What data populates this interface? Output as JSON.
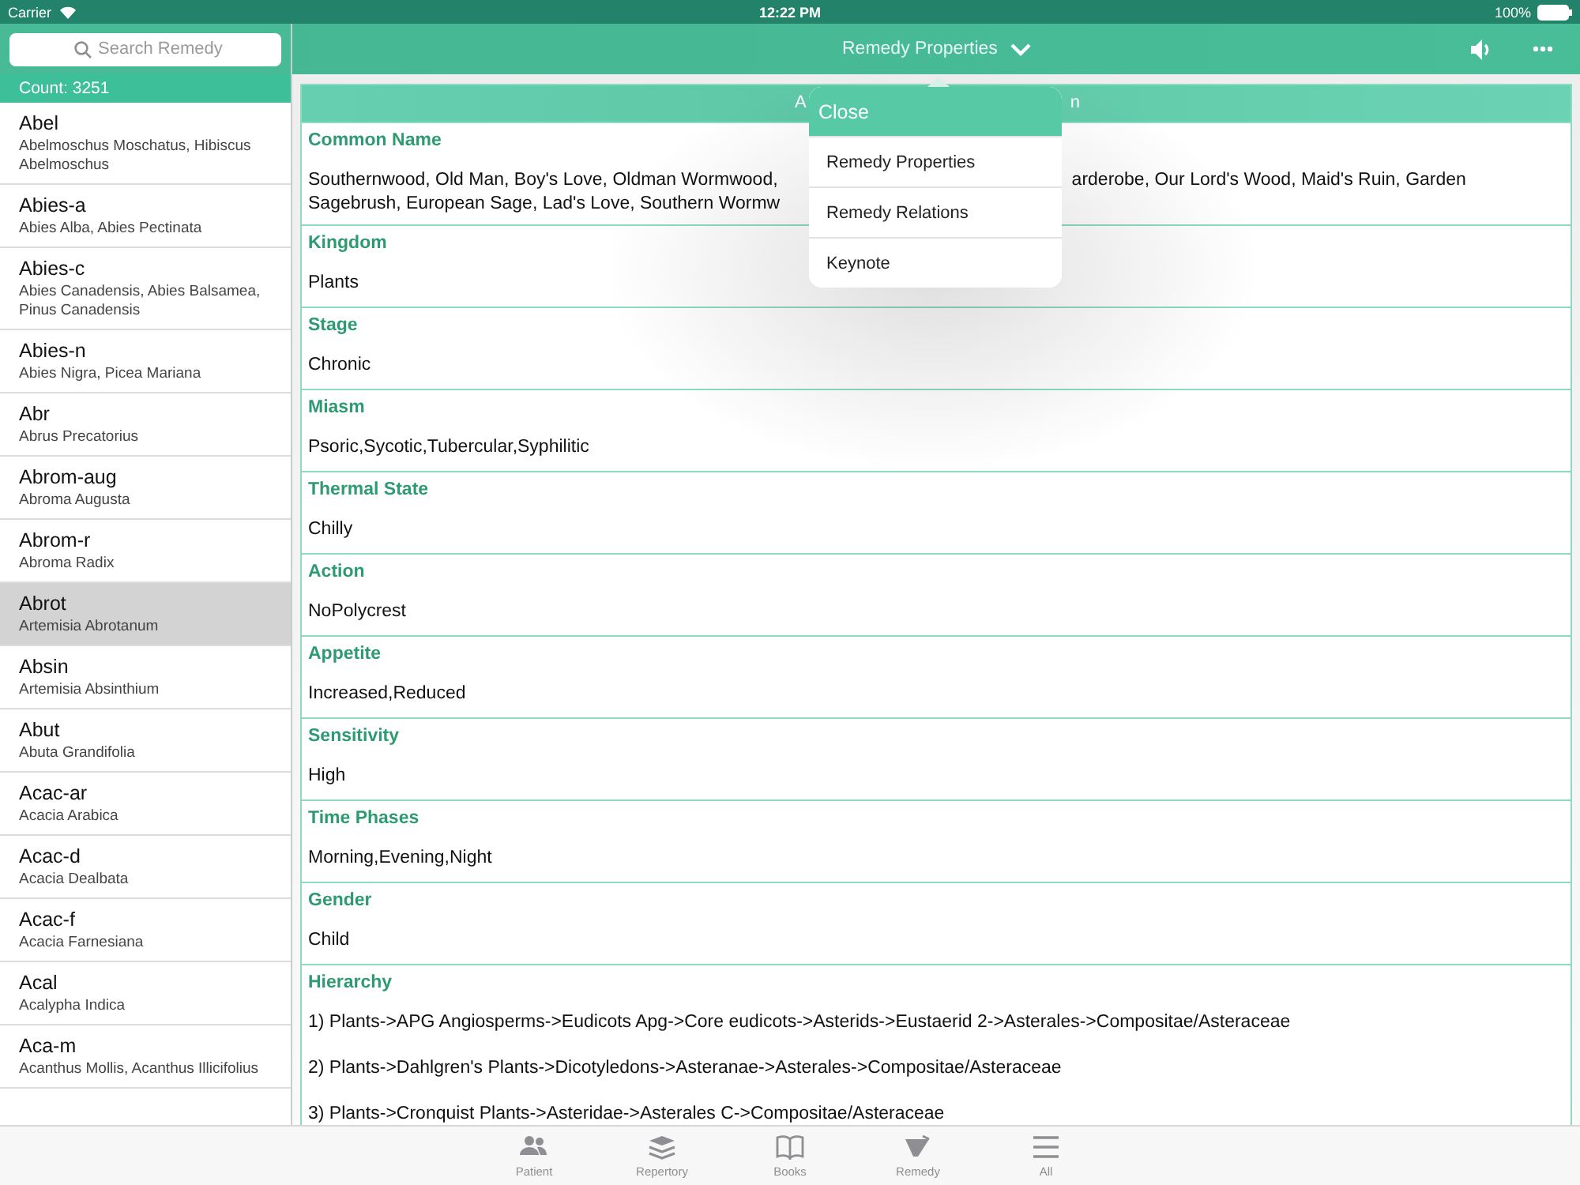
{
  "status_bar": {
    "carrier": "Carrier",
    "time": "12:22 PM",
    "battery": "100%"
  },
  "search": {
    "placeholder": "Search Remedy"
  },
  "nav": {
    "title": "Remedy Properties"
  },
  "count": "Count: 3251",
  "remedies": [
    {
      "abbr": "Abel",
      "name": "Abelmoschus Moschatus, Hibiscus Abelmoschus",
      "selected": false
    },
    {
      "abbr": "Abies-a",
      "name": "Abies Alba, Abies Pectinata",
      "selected": false
    },
    {
      "abbr": "Abies-c",
      "name": "Abies Canadensis, Abies Balsamea, Pinus Canadensis",
      "selected": false
    },
    {
      "abbr": "Abies-n",
      "name": "Abies Nigra, Picea Mariana",
      "selected": false
    },
    {
      "abbr": "Abr",
      "name": "Abrus Precatorius",
      "selected": false
    },
    {
      "abbr": "Abrom-aug",
      "name": "Abroma Augusta",
      "selected": false
    },
    {
      "abbr": "Abrom-r",
      "name": "Abroma Radix",
      "selected": false
    },
    {
      "abbr": "Abrot",
      "name": "Artemisia Abrotanum",
      "selected": true
    },
    {
      "abbr": "Absin",
      "name": "Artemisia Absinthium",
      "selected": false
    },
    {
      "abbr": "Abut",
      "name": "Abuta Grandifolia",
      "selected": false
    },
    {
      "abbr": "Acac-ar",
      "name": "Acacia Arabica",
      "selected": false
    },
    {
      "abbr": "Acac-d",
      "name": "Acacia Dealbata",
      "selected": false
    },
    {
      "abbr": "Acac-f",
      "name": "Acacia Farnesiana",
      "selected": false
    },
    {
      "abbr": "Acal",
      "name": "Acalypha Indica",
      "selected": false
    },
    {
      "abbr": "Aca-m",
      "name": "Acanthus Mollis, Acanthus Illicifolius",
      "selected": false
    }
  ],
  "header_fragments": [
    "A",
    "n"
  ],
  "properties": [
    {
      "label": "Common Name",
      "lines": [
        [
          "Southernwood, Old Man, Boy's Love, Oldman Wormwood,",
          "arderobe, Our Lord's Wood, Maid's Ruin, Garden"
        ],
        [
          "Sagebrush, European Sage, Lad's Love, Southern Wormw"
        ]
      ]
    },
    {
      "label": "Kingdom",
      "lines": [
        [
          "Plants"
        ]
      ]
    },
    {
      "label": "Stage",
      "lines": [
        [
          "Chronic"
        ]
      ]
    },
    {
      "label": "Miasm",
      "lines": [
        [
          "Psoric,Sycotic,Tubercular,Syphilitic"
        ]
      ]
    },
    {
      "label": "Thermal State",
      "lines": [
        [
          "Chilly"
        ]
      ]
    },
    {
      "label": "Action",
      "lines": [
        [
          "NoPolycrest"
        ]
      ]
    },
    {
      "label": "Appetite",
      "lines": [
        [
          "Increased,Reduced"
        ]
      ]
    },
    {
      "label": "Sensitivity",
      "lines": [
        [
          "High"
        ]
      ]
    },
    {
      "label": "Time Phases",
      "lines": [
        [
          "Morning,Evening,Night"
        ]
      ]
    },
    {
      "label": "Gender",
      "lines": [
        [
          "Child"
        ]
      ]
    },
    {
      "label": "Hierarchy",
      "paragraphs": [
        "1) Plants->APG Angiosperms->Eudicots Apg->Core eudicots->Asterids->Eustaerid 2->Asterales->Compositae/Asteraceae",
        "2) Plants->Dahlgren's Plants->Dicotyledons->Asteranae->Asterales->Compositae/Asteraceae",
        "3) Plants->Cronquist Plants->Asteridae->Asterales C->Compositae/Asteraceae"
      ]
    }
  ],
  "popover": {
    "close": "Close",
    "items": [
      "Remedy Properties",
      "Remedy Relations",
      "Keynote"
    ]
  },
  "tabs": [
    {
      "kind": "patient",
      "label": "Patient"
    },
    {
      "kind": "repertory",
      "label": "Repertory"
    },
    {
      "kind": "books",
      "label": "Books"
    },
    {
      "kind": "remedy",
      "label": "Remedy"
    },
    {
      "kind": "all",
      "label": "All"
    }
  ]
}
